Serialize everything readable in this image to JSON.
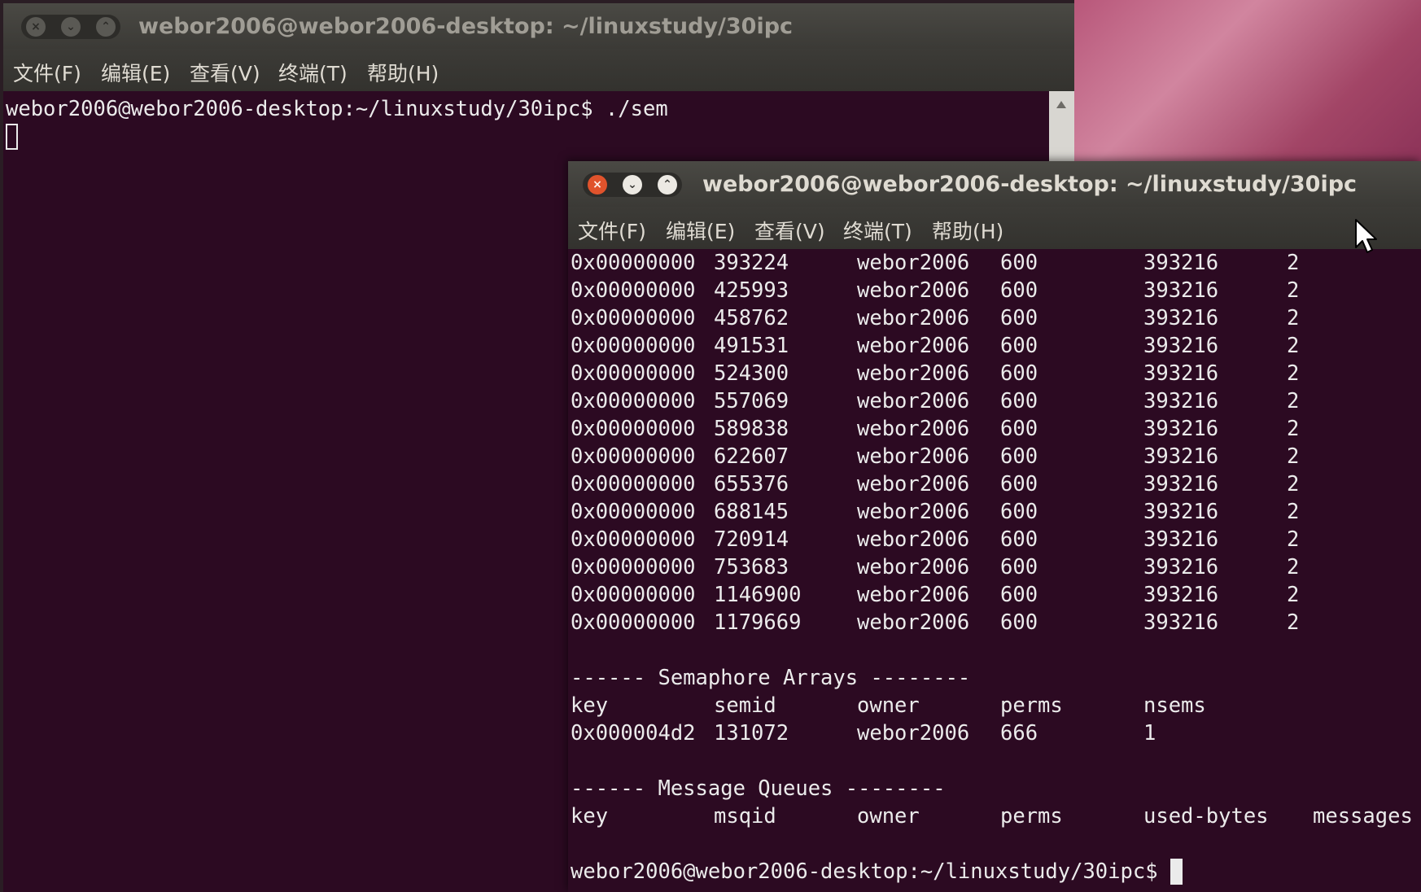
{
  "back_window": {
    "title": "webor2006@webor2006-desktop: ~/linuxstudy/30ipc",
    "menu": [
      "文件(F)",
      "编辑(E)",
      "查看(V)",
      "终端(T)",
      "帮助(H)"
    ],
    "command_line": "webor2006@webor2006-desktop:~/linuxstudy/30ipc$ ./sem"
  },
  "front_window": {
    "title": "webor2006@webor2006-desktop: ~/linuxstudy/30ipc",
    "menu": [
      "文件(F)",
      "编辑(E)",
      "查看(V)",
      "终端(T)",
      "帮助(H)"
    ],
    "shm_rows": [
      [
        "0x00000000",
        "393224",
        "webor2006",
        "600",
        "393216",
        "2"
      ],
      [
        "0x00000000",
        "425993",
        "webor2006",
        "600",
        "393216",
        "2"
      ],
      [
        "0x00000000",
        "458762",
        "webor2006",
        "600",
        "393216",
        "2"
      ],
      [
        "0x00000000",
        "491531",
        "webor2006",
        "600",
        "393216",
        "2"
      ],
      [
        "0x00000000",
        "524300",
        "webor2006",
        "600",
        "393216",
        "2"
      ],
      [
        "0x00000000",
        "557069",
        "webor2006",
        "600",
        "393216",
        "2"
      ],
      [
        "0x00000000",
        "589838",
        "webor2006",
        "600",
        "393216",
        "2"
      ],
      [
        "0x00000000",
        "622607",
        "webor2006",
        "600",
        "393216",
        "2"
      ],
      [
        "0x00000000",
        "655376",
        "webor2006",
        "600",
        "393216",
        "2"
      ],
      [
        "0x00000000",
        "688145",
        "webor2006",
        "600",
        "393216",
        "2"
      ],
      [
        "0x00000000",
        "720914",
        "webor2006",
        "600",
        "393216",
        "2"
      ],
      [
        "0x00000000",
        "753683",
        "webor2006",
        "600",
        "393216",
        "2"
      ],
      [
        "0x00000000",
        "1146900",
        "webor2006",
        "600",
        "393216",
        "2"
      ],
      [
        "0x00000000",
        "1179669",
        "webor2006",
        "600",
        "393216",
        "2"
      ]
    ],
    "sem_heading": "------ Semaphore Arrays --------",
    "sem_headers": [
      "key",
      "semid",
      "owner",
      "perms",
      "nsems"
    ],
    "sem_row": [
      "0x000004d2",
      "131072",
      "webor2006",
      "666",
      "1"
    ],
    "msg_heading": "------ Message Queues --------",
    "msg_headers": [
      "key",
      "msqid",
      "owner",
      "perms",
      "used-bytes",
      "messages"
    ],
    "prompt": "webor2006@webor2006-desktop:~/linuxstudy/30ipc$"
  },
  "colors": {
    "terminal_bg": "#2c0a22",
    "terminal_fg": "#ebebeb",
    "titlebar": "#3c3b37",
    "close_button": "#e0532c"
  },
  "icons": [
    "close-icon",
    "minimize-icon",
    "maximize-icon",
    "scroll-up-icon",
    "mouse-pointer-icon"
  ]
}
